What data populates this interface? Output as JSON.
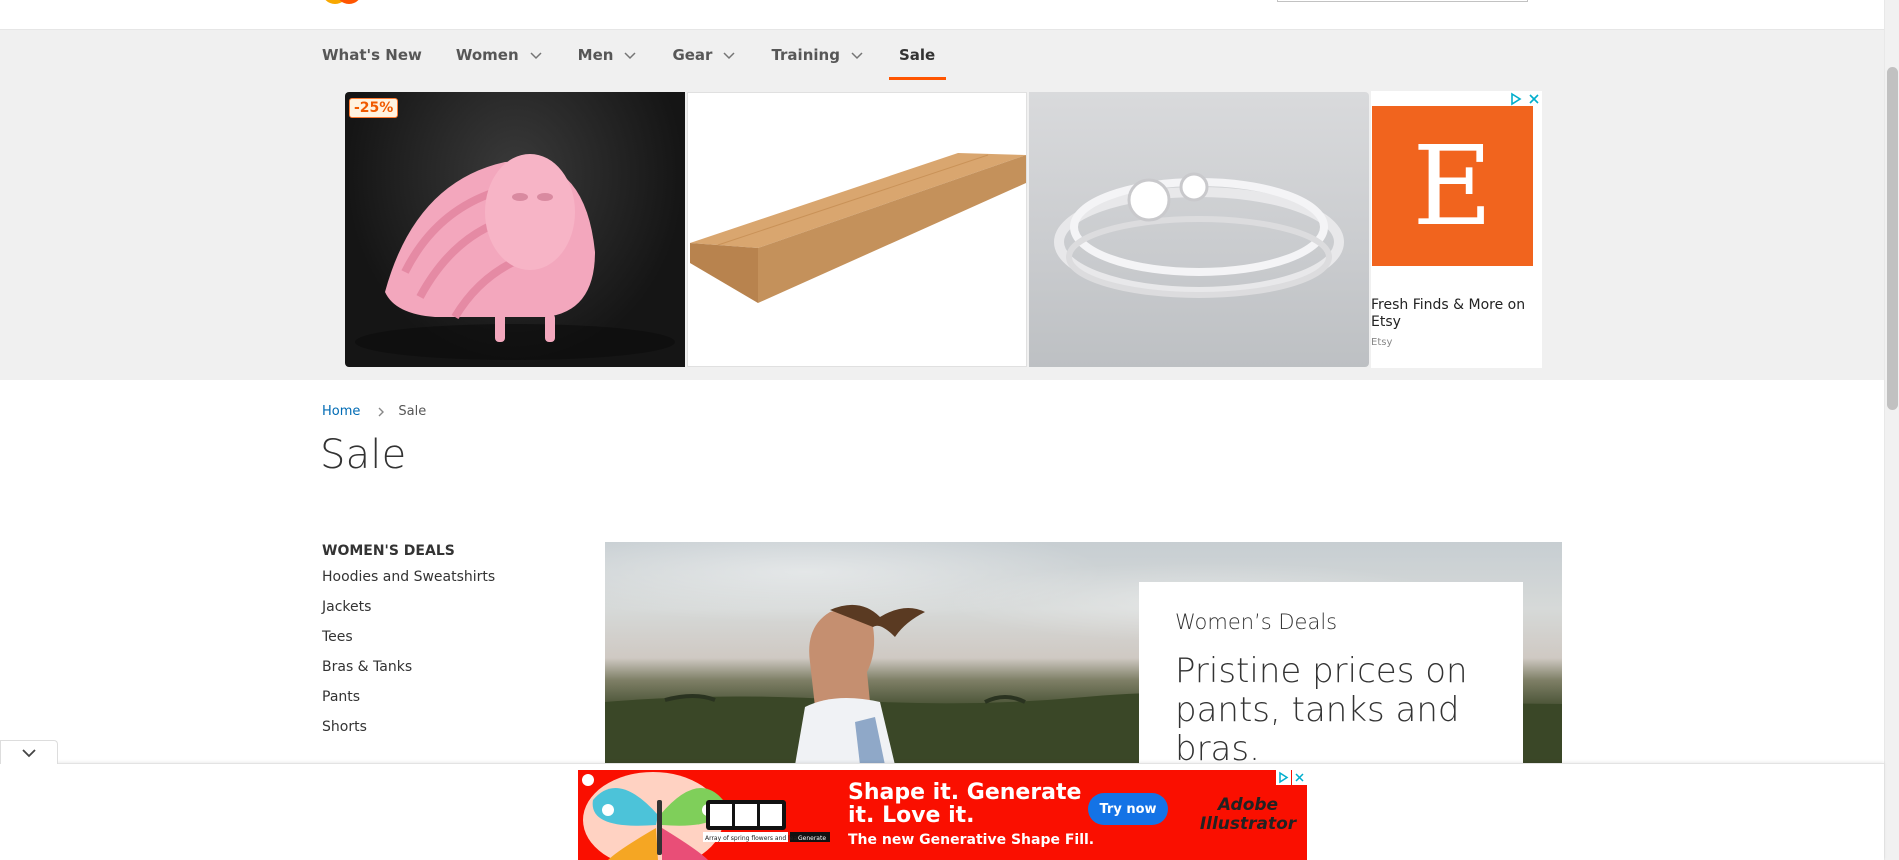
{
  "nav": {
    "items": [
      {
        "label": "What's New",
        "has_dropdown": false
      },
      {
        "label": "Women",
        "has_dropdown": true
      },
      {
        "label": "Men",
        "has_dropdown": true
      },
      {
        "label": "Gear",
        "has_dropdown": true
      },
      {
        "label": "Training",
        "has_dropdown": true
      },
      {
        "label": "Sale",
        "has_dropdown": false,
        "active": true
      }
    ]
  },
  "ad_banner": {
    "discount_badge": "-25%",
    "etsy_logo_letter": "E",
    "etsy_title": "Fresh Finds & More on Etsy",
    "etsy_source": "Etsy",
    "colors": {
      "etsy_orange": "#f1641e",
      "badge_orange": "#ff7a30"
    }
  },
  "breadcrumb": {
    "home": "Home",
    "current": "Sale"
  },
  "page_title": "Sale",
  "sidebar": {
    "heading": "WOMEN'S DEALS",
    "links": [
      "Hoodies and Sweatshirts",
      "Jackets",
      "Tees",
      "Bras & Tanks",
      "Pants",
      "Shorts"
    ]
  },
  "hero": {
    "kicker": "Women’s Deals",
    "headline": "Pristine prices on pants, tanks and bras."
  },
  "bottom_ad": {
    "headline": "Shape it. Generate it. Love it.",
    "subline": "The new Generative Shape Fill.",
    "cta": "Try now",
    "brand": "Adobe Illustrator",
    "mini_prompt": "Array of spring flowers and leaves",
    "mini_button": "Generate",
    "colors": {
      "background": "#fa0f00",
      "cta": "#1473e6"
    }
  },
  "colors": {
    "accent": "#ff5501",
    "link": "#006bb4",
    "nav_band": "#f0f0f0"
  }
}
